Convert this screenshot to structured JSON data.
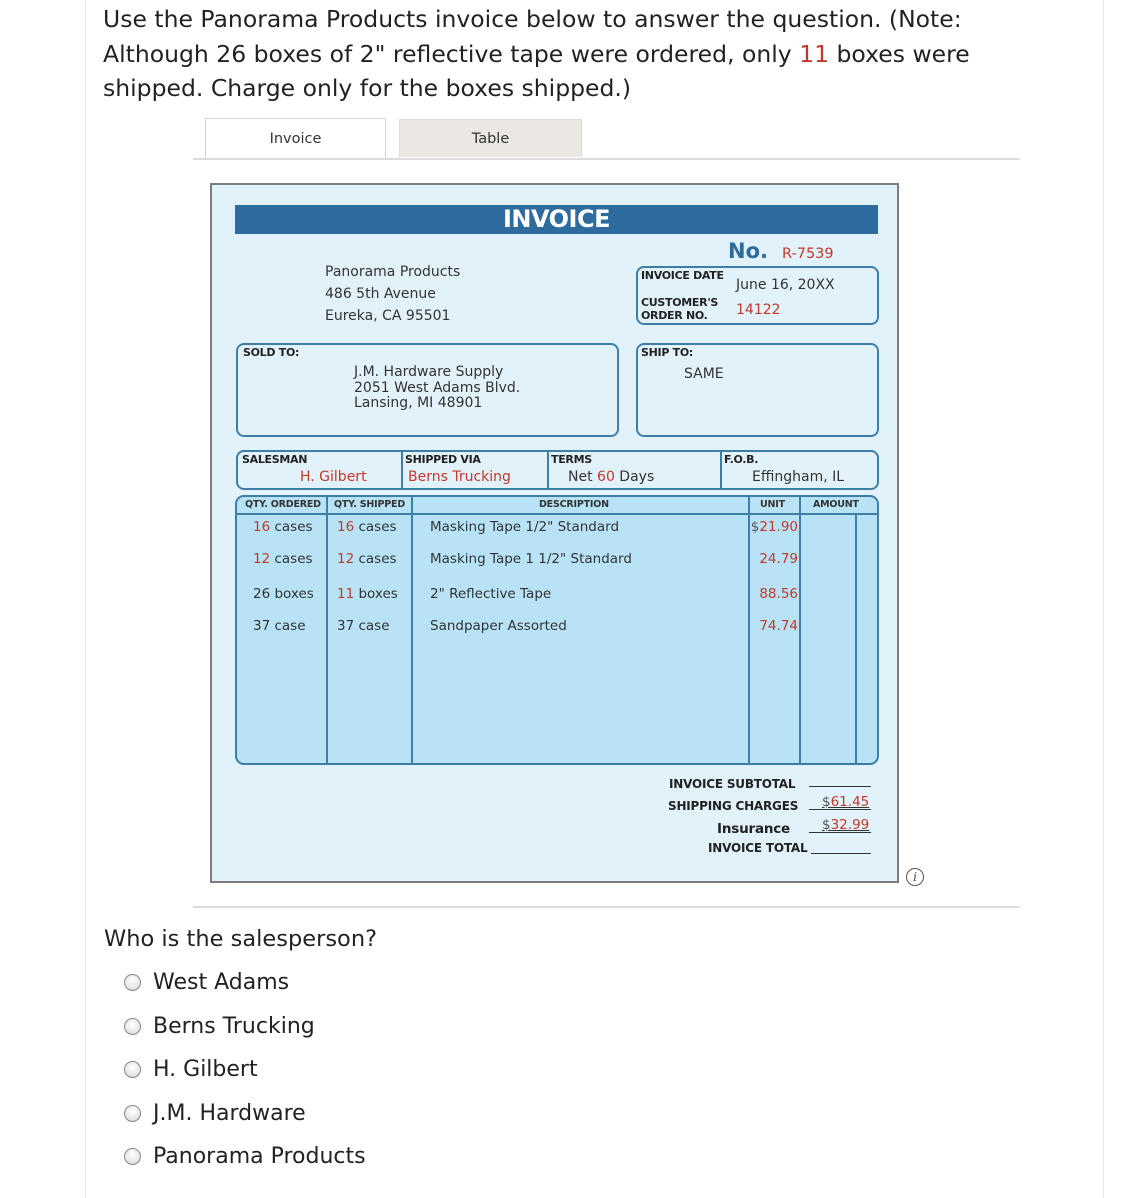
{
  "prompt": {
    "line1": "Use the Panorama Products invoice below to answer the question. (Note:",
    "line2_before": "Although 26 boxes of 2\" reflective tape were ordered, only ",
    "line2_highlight": "11",
    "line2_after": " boxes were",
    "line3": "shipped. Charge only for the boxes shipped.)"
  },
  "tabs": [
    {
      "label": "Invoice",
      "active": true
    },
    {
      "label": "Table",
      "active": false
    }
  ],
  "invoice": {
    "title": "INVOICE",
    "number_label": "No.",
    "number": "R-7539",
    "seller": {
      "name": "Panorama Products",
      "street": "486 5th Avenue",
      "city": "Eureka, CA 95501"
    },
    "invoice_date_label": "INVOICE DATE",
    "invoice_date": "June 16, 20XX",
    "order_no_label_1": "CUSTOMER'S",
    "order_no_label_2": "ORDER NO.",
    "order_no": "14122",
    "sold_to_label": "SOLD TO:",
    "sold_to": {
      "name": "J.M. Hardware Supply",
      "street": "2051 West Adams Blvd.",
      "city": "Lansing, MI 48901"
    },
    "ship_to_label": "SHIP TO:",
    "ship_to": "SAME",
    "salesman_label": "SALESMAN",
    "salesman": "H. Gilbert",
    "shipped_via_label": "SHIPPED VIA",
    "shipped_via": "Berns Trucking",
    "terms_label": "TERMS",
    "terms_prefix": "Net ",
    "terms_days": "60",
    "terms_suffix": " Days",
    "fob_label": "F.O.B.",
    "fob": "Effingham, IL",
    "columns": [
      "QTY. ORDERED",
      "QTY. SHIPPED",
      "DESCRIPTION",
      "UNIT",
      "AMOUNT"
    ],
    "items": [
      {
        "ordered_qty": "16",
        "ordered_unit": " cases",
        "ordered_red": true,
        "shipped_qty": "16",
        "shipped_unit": " cases",
        "shipped_red": true,
        "description": "Masking Tape 1/2\" Standard",
        "unit_prefix": "$",
        "unit_price": "21.90",
        "amount": ""
      },
      {
        "ordered_qty": "12",
        "ordered_unit": " cases",
        "ordered_red": true,
        "shipped_qty": "12",
        "shipped_unit": " cases",
        "shipped_red": true,
        "description": "Masking Tape 1 1/2\" Standard",
        "unit_prefix": "",
        "unit_price": "24.79",
        "amount": ""
      },
      {
        "ordered_qty": "26",
        "ordered_unit": " boxes",
        "ordered_red": false,
        "shipped_qty": "11",
        "shipped_unit": " boxes",
        "shipped_red": true,
        "description": "2\" Reflective Tape",
        "unit_prefix": "",
        "unit_price": "88.56",
        "amount": ""
      },
      {
        "ordered_qty": "37",
        "ordered_unit": " case",
        "ordered_red": false,
        "shipped_qty": "37",
        "shipped_unit": " case",
        "shipped_red": false,
        "description": "Sandpaper Assorted",
        "unit_prefix": "",
        "unit_price": "74.74",
        "amount": ""
      }
    ],
    "subtotal_label": "INVOICE SUBTOTAL",
    "subtotal": "",
    "shipping_label": "SHIPPING CHARGES",
    "shipping_prefix": "$",
    "shipping": "61.45",
    "insurance_label": "Insurance",
    "insurance_prefix": "$",
    "insurance": "32.99",
    "total_label": "INVOICE TOTAL",
    "total": ""
  },
  "info_icon": "i",
  "question": {
    "text": "Who is the salesperson?",
    "options": [
      "West Adams",
      "Berns Trucking",
      "H. Gilbert",
      "J.M. Hardware",
      "Panorama Products"
    ]
  },
  "colors": {
    "accent_red": "#c0392b",
    "invoice_blue": "#2e6b9e",
    "invoice_bg": "#e2f2fb",
    "table_bg": "#b8e3f6"
  }
}
